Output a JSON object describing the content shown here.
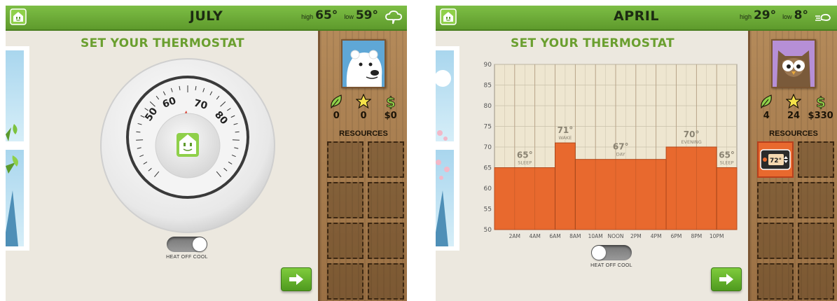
{
  "left_screen": {
    "month": "JULY",
    "weather": {
      "high_label": "high",
      "high_value": "65°",
      "low_label": "low",
      "low_value": "59°",
      "icon": "cloud-icon"
    },
    "heading": "SET YOUR THERMOSTAT",
    "dial": {
      "ticks": [
        "50",
        "60",
        "70",
        "80"
      ],
      "marker_color": "#d93a2b"
    },
    "stats": [
      {
        "icon": "leaf-icon",
        "value": "0"
      },
      {
        "icon": "star-icon",
        "value": "0"
      },
      {
        "icon": "dollar-icon",
        "value": "$0"
      }
    ],
    "resources_label": "RESOURCES",
    "toggle": {
      "label": "HEAT OFF COOL",
      "state": "cool"
    }
  },
  "right_screen": {
    "month": "APRIL",
    "weather": {
      "high_label": "high",
      "high_value": "29°",
      "low_label": "low",
      "low_value": "8°",
      "icon": "wind-icon"
    },
    "heading": "SET YOUR THERMOSTAT",
    "stats": [
      {
        "icon": "leaf-icon",
        "value": "4"
      },
      {
        "icon": "star-icon",
        "value": "24"
      },
      {
        "icon": "dollar-icon",
        "value": "$330"
      }
    ],
    "resources_label": "RESOURCES",
    "resource_item": {
      "icon": "thermostat-icon",
      "value": "72°"
    },
    "toggle": {
      "label": "HEAT OFF COOL",
      "state": "off"
    }
  },
  "colors": {
    "topbar": "#6aaa35",
    "heading": "#6a9f2f",
    "bar": "#e8692e",
    "sidebar": "#a97e4f"
  },
  "chart_data": {
    "type": "area",
    "y_ticks": [
      50,
      55,
      60,
      65,
      70,
      75,
      80,
      85,
      90
    ],
    "ylim": [
      50,
      90
    ],
    "x_ticks": [
      "2AM",
      "4AM",
      "6AM",
      "8AM",
      "10AM",
      "NOON",
      "2PM",
      "4PM",
      "6PM",
      "8PM",
      "10PM"
    ],
    "segments": [
      {
        "start": 0,
        "end": 6,
        "value": 65
      },
      {
        "start": 6,
        "end": 8,
        "value": 71
      },
      {
        "start": 8,
        "end": 17,
        "value": 67
      },
      {
        "start": 17,
        "end": 22,
        "value": 70
      },
      {
        "start": 22,
        "end": 24,
        "value": 65
      }
    ],
    "annotations": [
      {
        "temp": "65°",
        "label": "SLEEP",
        "hour": 3,
        "value": 65
      },
      {
        "temp": "71°",
        "label": "WAKE",
        "hour": 7,
        "value": 71
      },
      {
        "temp": "67°",
        "label": "DAY",
        "hour": 12.5,
        "value": 67
      },
      {
        "temp": "70°",
        "label": "EVENING",
        "hour": 19.5,
        "value": 70
      },
      {
        "temp": "65°",
        "label": "SLEEP",
        "hour": 23,
        "value": 65
      }
    ],
    "grid": true
  }
}
